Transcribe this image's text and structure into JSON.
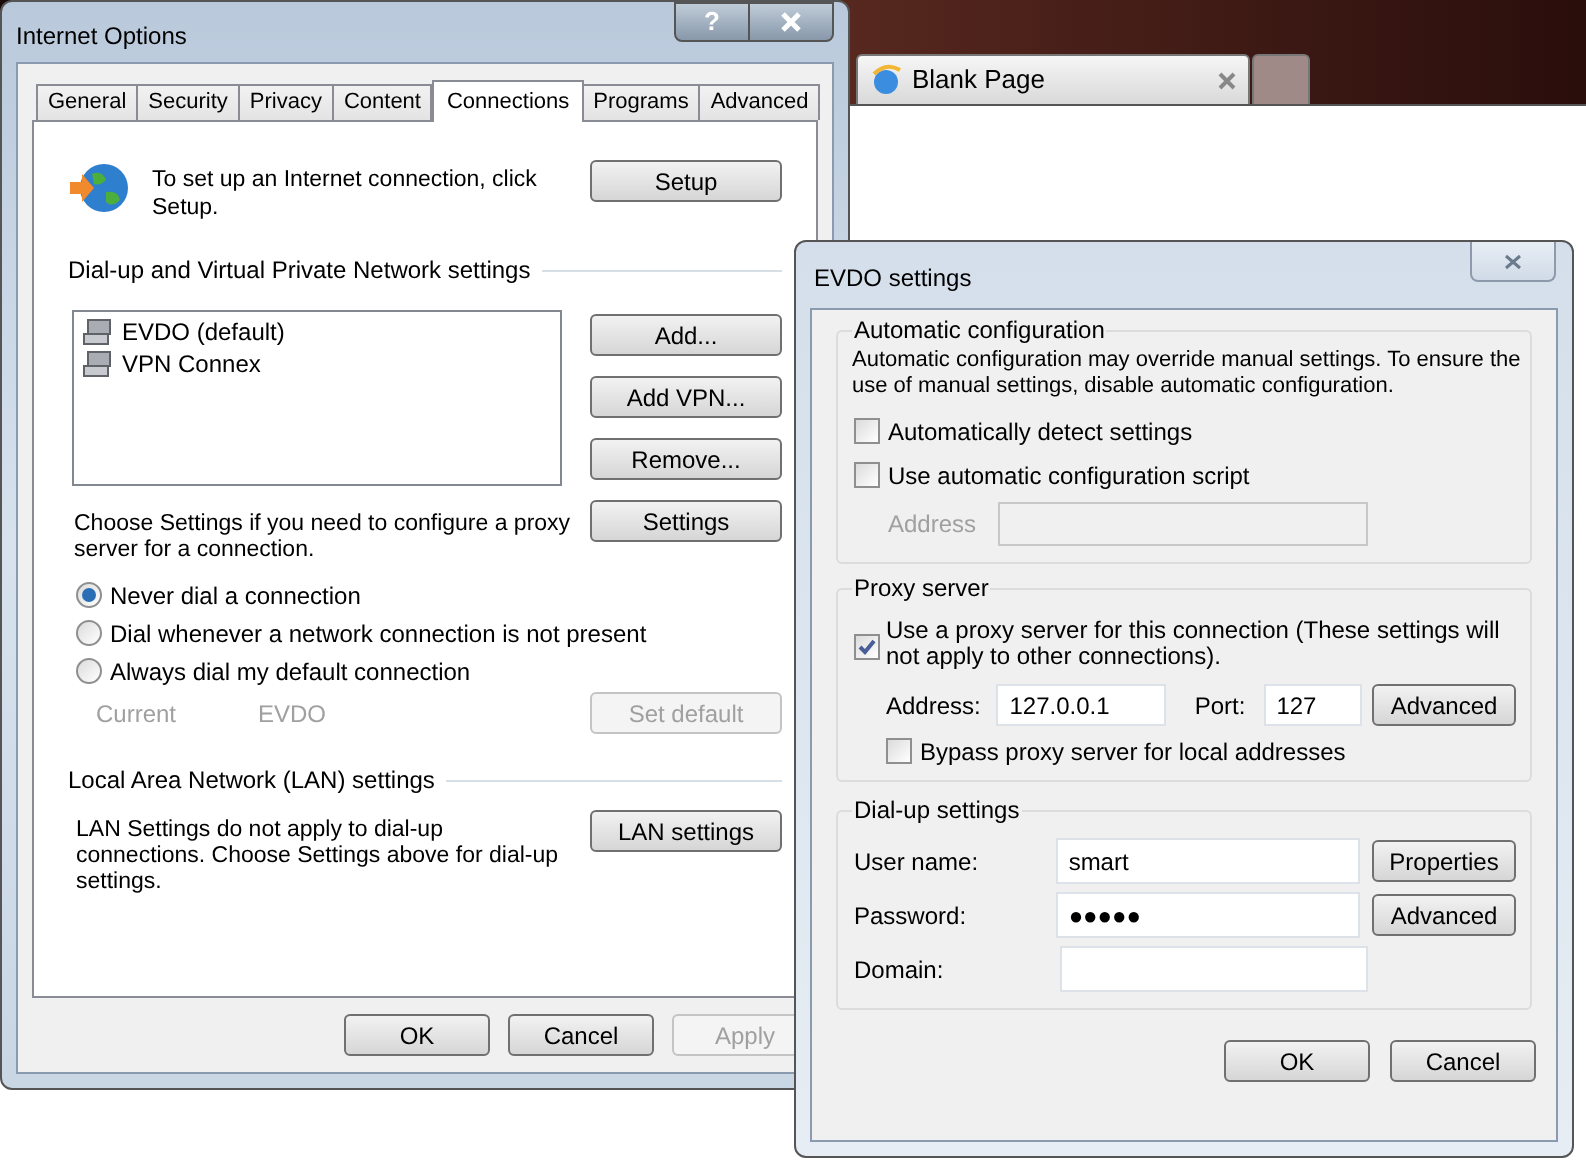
{
  "browser_tab": {
    "title": "Blank Page"
  },
  "internet_options": {
    "title": "Internet Options",
    "help_button": "?",
    "tabs": [
      {
        "label": "General",
        "selected": false
      },
      {
        "label": "Security",
        "selected": false
      },
      {
        "label": "Privacy",
        "selected": false
      },
      {
        "label": "Content",
        "selected": false
      },
      {
        "label": "Connections",
        "selected": true
      },
      {
        "label": "Programs",
        "selected": false
      },
      {
        "label": "Advanced",
        "selected": false
      }
    ],
    "setup": {
      "text": "To set up an Internet connection, click Setup.",
      "button": "Setup"
    },
    "vpn": {
      "heading": "Dial-up and Virtual Private Network settings",
      "connections": [
        {
          "name": "EVDO (default)"
        },
        {
          "name": "VPN Connex"
        }
      ],
      "buttons": [
        {
          "label": "Add..."
        },
        {
          "label": "Add VPN..."
        },
        {
          "label": "Remove..."
        }
      ],
      "settings_text": "Choose Settings if you need to configure a proxy server for a connection.",
      "settings_button": "Settings",
      "radios": [
        {
          "label": "Never dial a connection",
          "selected": true
        },
        {
          "label": "Dial whenever a network connection is not present",
          "selected": false
        },
        {
          "label": "Always dial my default connection",
          "selected": false
        }
      ],
      "current": {
        "label": "Current",
        "value": "EVDO",
        "disabled": true
      },
      "set_default": {
        "label": "Set default",
        "disabled": true
      }
    },
    "lan": {
      "heading": "Local Area Network (LAN) settings",
      "text": "LAN Settings do not apply to dial-up connections. Choose Settings above for dial-up settings.",
      "button": "LAN settings"
    },
    "buttons": [
      {
        "label": "OK",
        "disabled": false
      },
      {
        "label": "Cancel",
        "disabled": false
      },
      {
        "label": "Apply",
        "disabled": true
      }
    ]
  },
  "evdo_settings": {
    "title": "EVDO settings",
    "auto_config": {
      "heading": "Automatic configuration",
      "description": "Automatic configuration may override manual settings.  To ensure the use of manual settings, disable automatic configuration.",
      "checkboxes": [
        {
          "label": "Automatically detect settings",
          "checked": false
        },
        {
          "label": "Use automatic configuration script",
          "checked": false
        }
      ],
      "address": {
        "label": "Address",
        "disabled": true
      }
    },
    "proxy": {
      "heading": "Proxy server",
      "use_proxy": {
        "label": "Use a proxy server for this connection (These settings will not apply to other connections).",
        "checked": true
      },
      "address_label": "Address:",
      "address": "127.0.0.1",
      "port_label": "Port:",
      "port": "127",
      "advanced_button": "Advanced",
      "bypass": {
        "label": "Bypass proxy server for local addresses",
        "checked": false
      }
    },
    "dialup": {
      "heading": "Dial-up settings",
      "fields": [
        {
          "label": "User name:",
          "value": "smart",
          "button": "Properties"
        },
        {
          "label": "Password:",
          "value": "●●●●●",
          "button": "Advanced"
        },
        {
          "label": "Domain:"
        }
      ]
    },
    "buttons": [
      {
        "label": "OK"
      },
      {
        "label": "Cancel"
      }
    ]
  }
}
